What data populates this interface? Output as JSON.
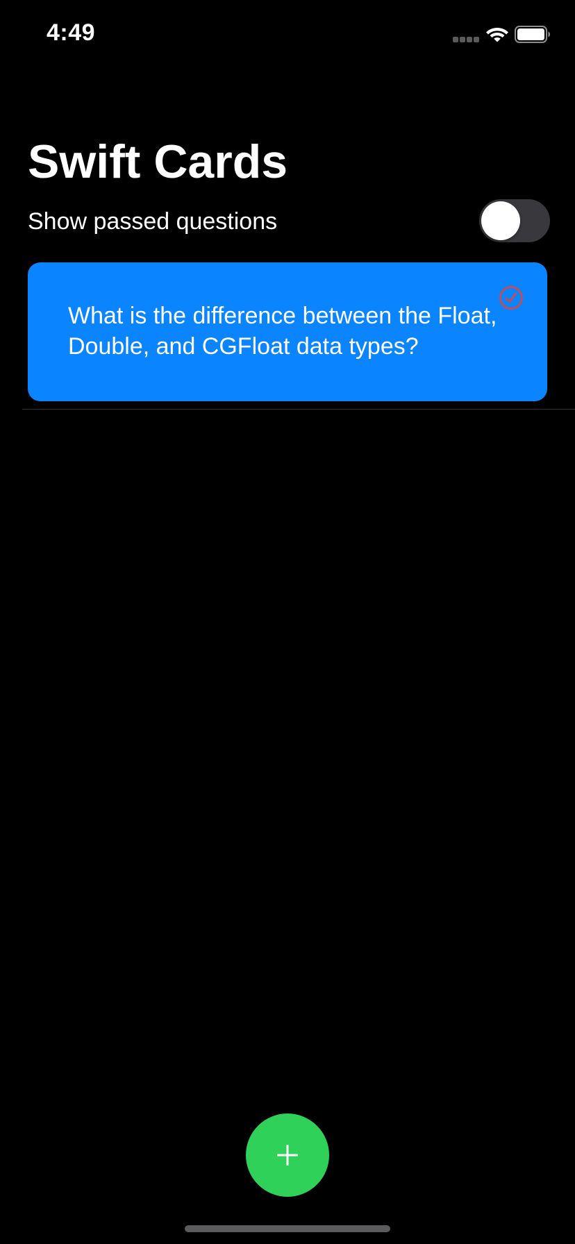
{
  "status_bar": {
    "time": "4:49",
    "signal_icon": "cellular-signal-icon",
    "wifi_icon": "wifi-icon",
    "battery_icon": "battery-icon"
  },
  "header": {
    "title": "Swift Cards"
  },
  "filter": {
    "toggle_label": "Show passed questions",
    "toggle_on": false
  },
  "cards": [
    {
      "question": "What is the difference between the Float, Double, and CGFloat data types?",
      "status_icon": "checkmark-circle-icon",
      "background_color": "#0a84ff",
      "status_icon_color": "#e0443e"
    }
  ],
  "actions": {
    "add_icon": "plus-icon",
    "add_button_color": "#30d158"
  }
}
